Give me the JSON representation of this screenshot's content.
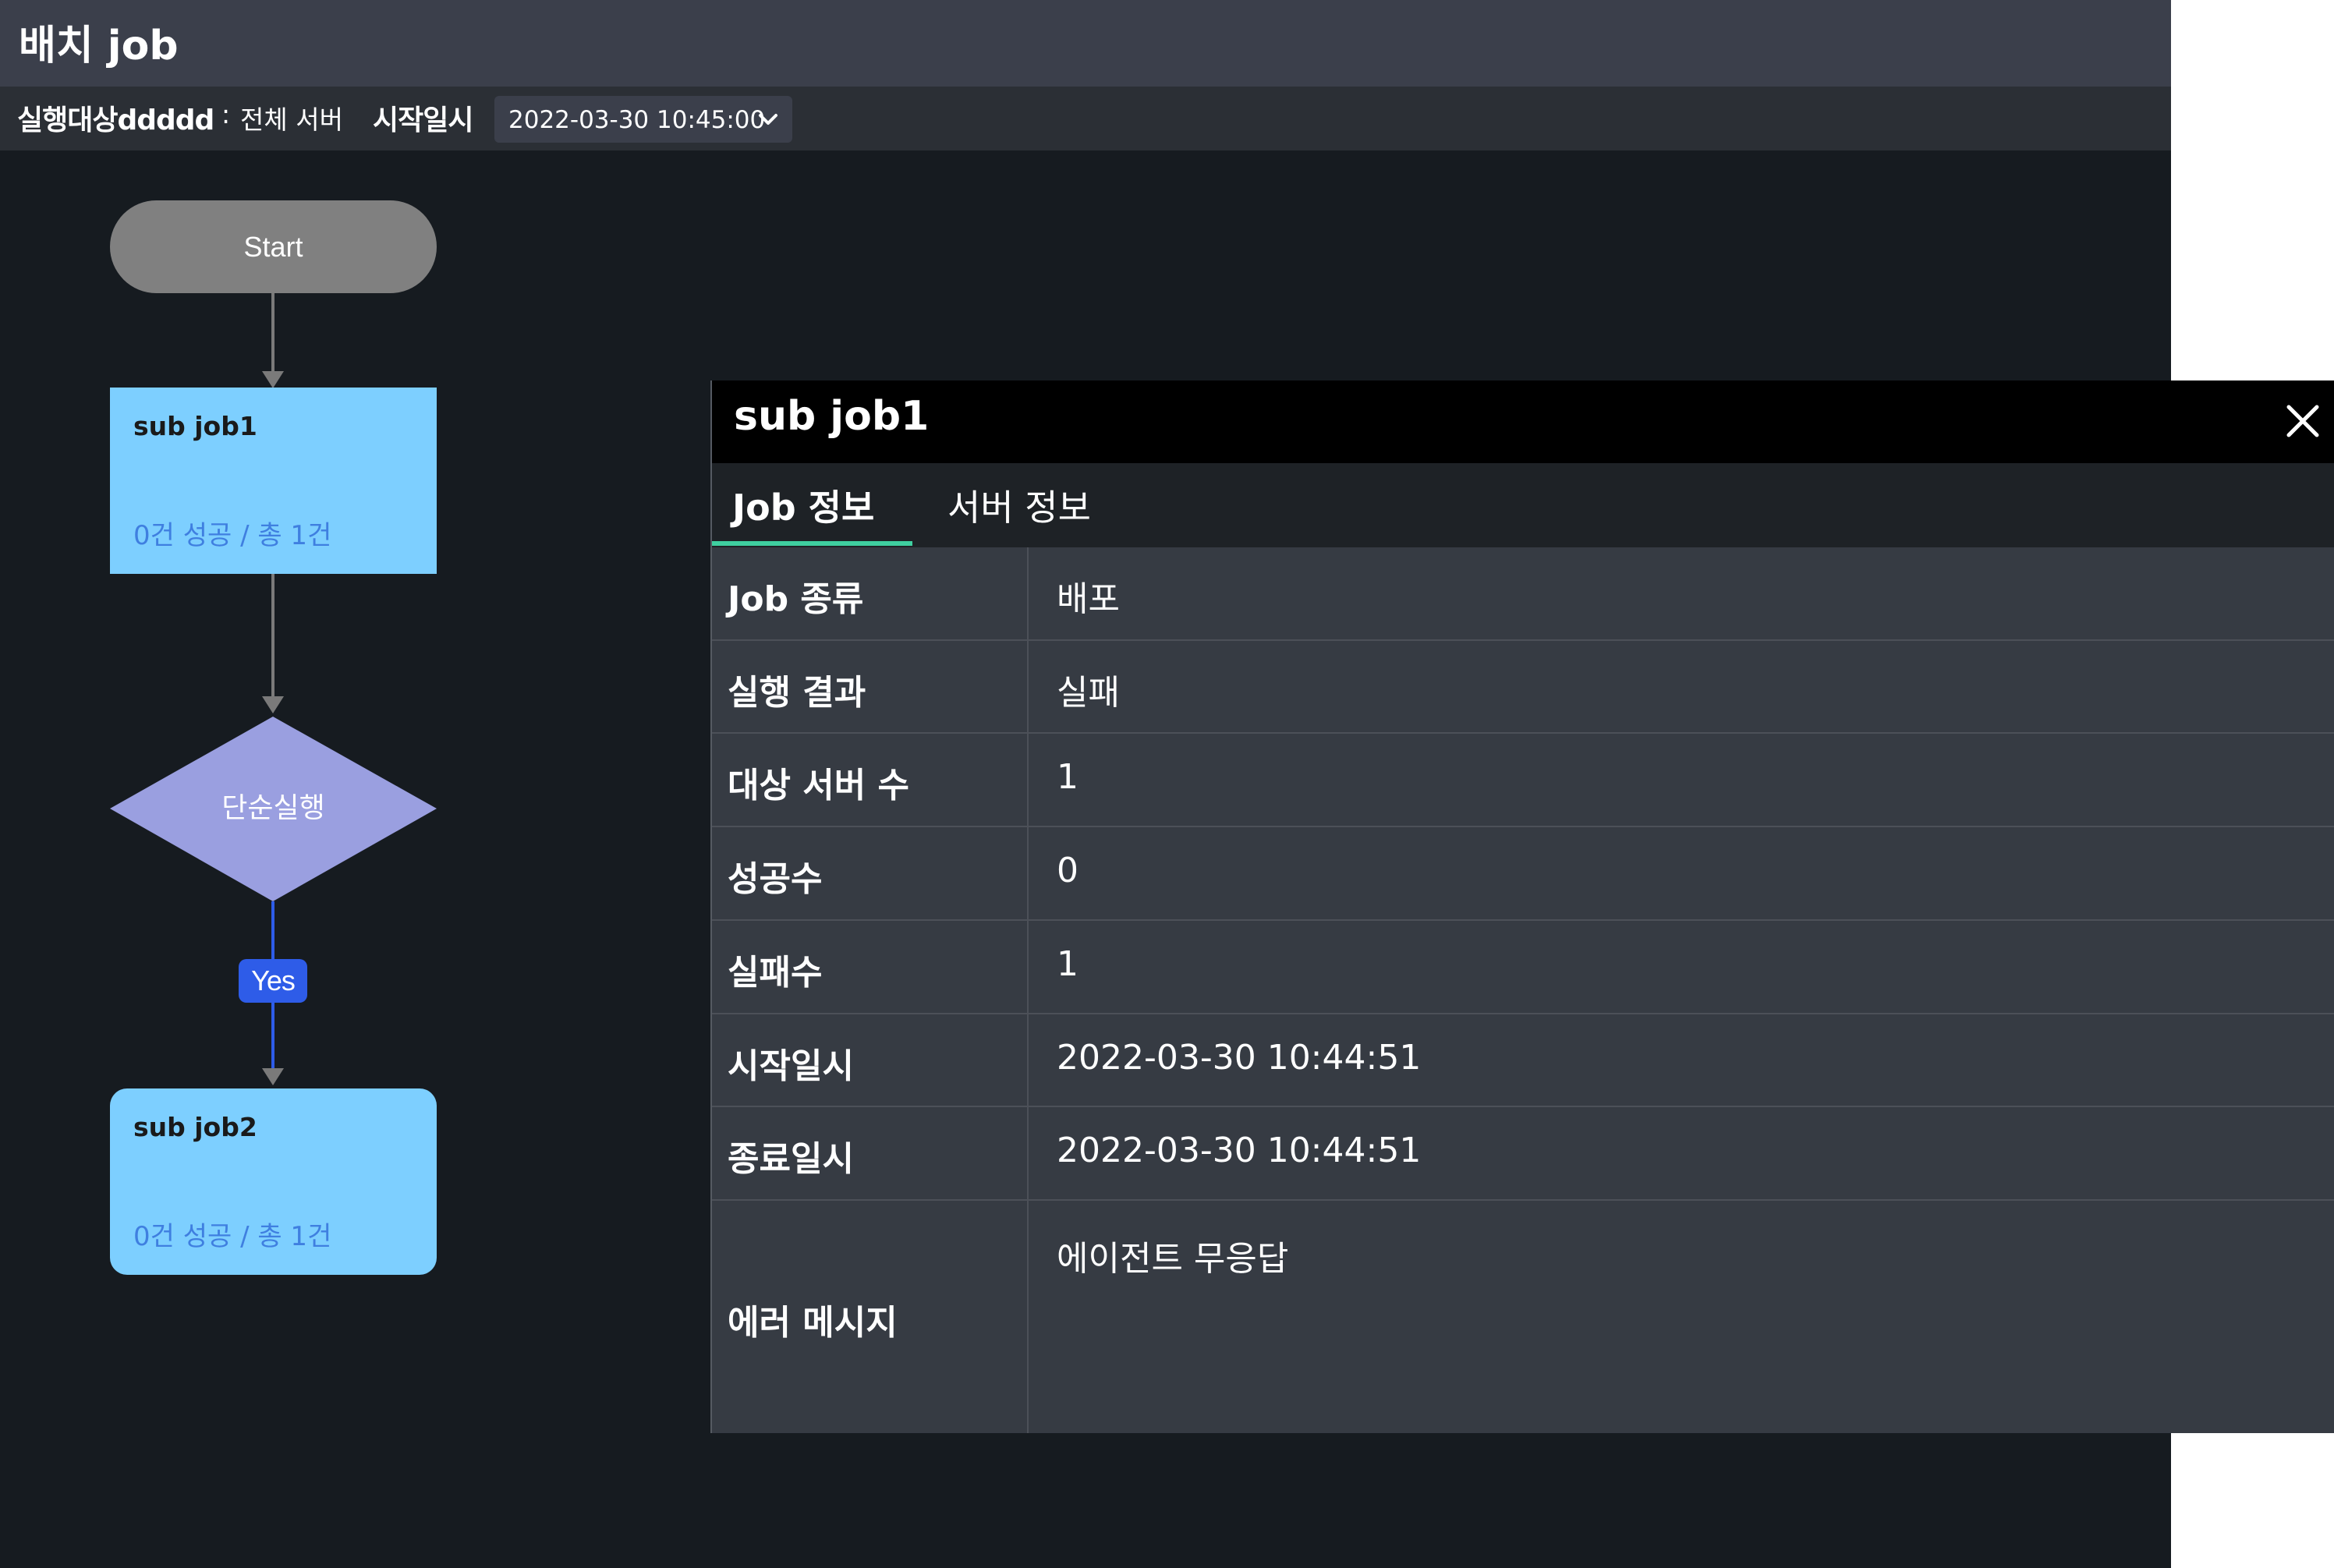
{
  "header": {
    "title": "배치 job"
  },
  "filters": {
    "target_label": "실행대상ddddd",
    "target_separator": " : ",
    "target_value": "전체 서버",
    "start_label": "시작일시",
    "start_value": "2022-03-30 10:45:00"
  },
  "flow": {
    "start_label": "Start",
    "jobs": [
      {
        "name": "sub job1",
        "stat": "0건 성공 / 총 1건"
      },
      {
        "name": "sub job2",
        "stat": "0건 성공 / 총 1건"
      }
    ],
    "decision_label": "단순실행",
    "edge_label": "Yes"
  },
  "panel": {
    "title": "sub job1",
    "tabs": [
      {
        "label": "Job 정보",
        "active": true
      },
      {
        "label": "서버 정보",
        "active": false
      }
    ],
    "rows": [
      {
        "key": "Job 종류",
        "value": "배포"
      },
      {
        "key": "실행 결과",
        "value": "실패"
      },
      {
        "key": "대상 서버 수",
        "value": "1"
      },
      {
        "key": "성공수",
        "value": "0"
      },
      {
        "key": "실패수",
        "value": "1"
      },
      {
        "key": "시작일시",
        "value": "2022-03-30 10:44:51"
      },
      {
        "key": "종료일시",
        "value": "2022-03-30 10:44:51"
      },
      {
        "key": "에러 메시지",
        "value": "에이전트 무응답"
      }
    ]
  },
  "colors": {
    "job_node": "#7dcfff",
    "decision_node": "#9a9fe0",
    "start_node": "#808080",
    "edge_yes": "#2e5ce8",
    "tab_accent": "#3fcfa0"
  }
}
